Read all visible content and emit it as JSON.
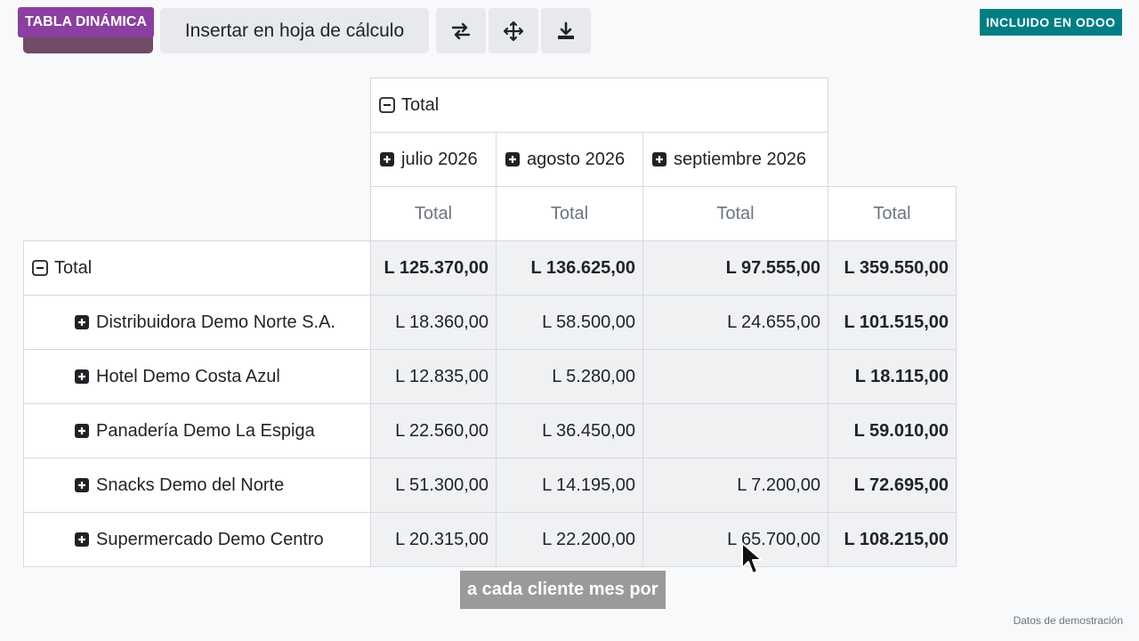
{
  "toolbar": {
    "pivot_tag": "TABLA DINÁMICA",
    "insert_label": "Insertar en hoja de cálculo",
    "buttons": [
      {
        "icon": "flip-axis-icon"
      },
      {
        "icon": "expand-all-icon"
      },
      {
        "icon": "download-icon"
      }
    ]
  },
  "badge": "INCLUIDO EN ODOO",
  "pivot": {
    "col_group_header": "Total",
    "months": [
      "julio 2026",
      "agosto 2026",
      "septiembre 2026"
    ],
    "measure_headers": [
      "Total",
      "Total",
      "Total",
      "Total"
    ],
    "total_row": {
      "label": "Total",
      "values": [
        "L 125.370,00",
        "L 136.625,00",
        "L 97.555,00",
        "L 359.550,00"
      ]
    },
    "rows": [
      {
        "label": "Distribuidora Demo Norte S.A.",
        "values": [
          "L 18.360,00",
          "L 58.500,00",
          "L 24.655,00",
          "L 101.515,00"
        ]
      },
      {
        "label": "Hotel Demo Costa Azul",
        "values": [
          "L 12.835,00",
          "L 5.280,00",
          "",
          "L 18.115,00"
        ]
      },
      {
        "label": "Panadería Demo La Espiga",
        "values": [
          "L 22.560,00",
          "L 36.450,00",
          "",
          "L 59.010,00"
        ]
      },
      {
        "label": "Snacks Demo del Norte",
        "values": [
          "L 51.300,00",
          "L 14.195,00",
          "L 7.200,00",
          "L 72.695,00"
        ]
      },
      {
        "label": "Supermercado Demo Centro",
        "values": [
          "L 20.315,00",
          "L 22.200,00",
          "L 65.700,00",
          "L 108.215,00"
        ]
      }
    ]
  },
  "subtitle": "a cada cliente mes por",
  "demo_note": "Datos de demostración",
  "colors": {
    "pivot_tag": "#8b3fa0",
    "primary": "#714b67",
    "odoo_badge": "#017e84"
  }
}
